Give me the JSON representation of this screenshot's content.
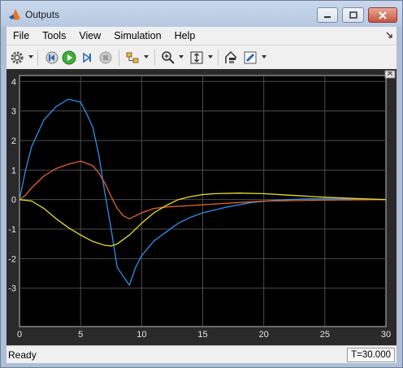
{
  "window": {
    "title": "Outputs"
  },
  "menu": {
    "items": [
      "File",
      "Tools",
      "View",
      "Simulation",
      "Help"
    ]
  },
  "toolbar": {
    "icons": [
      "gear-icon",
      "step-back-icon",
      "run-icon",
      "step-forward-icon",
      "stop-icon",
      "signal-select-icon",
      "zoom-icon",
      "fit-axes-icon",
      "style-icon",
      "highlight-icon"
    ]
  },
  "status": {
    "text": "Ready",
    "time": "T=30.000"
  },
  "chart_data": {
    "type": "line",
    "xlim": [
      0,
      30
    ],
    "ylim": [
      -4.3,
      4.2
    ],
    "x_ticks": [
      0,
      5,
      10,
      15,
      20,
      25,
      30
    ],
    "y_ticks": [
      4,
      3,
      2,
      1,
      0,
      -1,
      -2,
      -3
    ],
    "x_tick_labels": [
      "0",
      "5",
      "10",
      "15",
      "20",
      "25",
      "30"
    ],
    "y_tick_labels": [
      "4",
      "3",
      "2",
      "1",
      "0",
      "-1",
      "-2",
      "-3"
    ],
    "grid": true,
    "series": [
      {
        "color": "#2f8fe6",
        "x": [
          0,
          0.5,
          1,
          2,
          3,
          4,
          5,
          5.5,
          6,
          6.5,
          7,
          7.5,
          8,
          8.5,
          9,
          9.5,
          10,
          11,
          12,
          13,
          14,
          15,
          17,
          19,
          21,
          24,
          27,
          30
        ],
        "y": [
          0,
          1.0,
          1.8,
          2.7,
          3.15,
          3.4,
          3.3,
          2.9,
          2.45,
          1.5,
          0.2,
          -1.0,
          -2.3,
          -2.6,
          -2.9,
          -2.3,
          -1.9,
          -1.4,
          -1.1,
          -0.8,
          -0.6,
          -0.45,
          -0.25,
          -0.1,
          -0.02,
          0.03,
          0.02,
          0.0
        ]
      },
      {
        "color": "#e2632f",
        "x": [
          0,
          0.5,
          1,
          2,
          3,
          4,
          5,
          6,
          6.5,
          7,
          7.5,
          8,
          8.5,
          9,
          10,
          11,
          12,
          14,
          16,
          18,
          20,
          25,
          30
        ],
        "y": [
          0,
          0.15,
          0.4,
          0.8,
          1.05,
          1.2,
          1.3,
          1.15,
          0.9,
          0.55,
          0.1,
          -0.3,
          -0.55,
          -0.65,
          -0.45,
          -0.3,
          -0.25,
          -0.2,
          -0.15,
          -0.1,
          -0.05,
          -0.02,
          0.0
        ]
      },
      {
        "color": "#e7de2b",
        "x": [
          0,
          1,
          2,
          3,
          4,
          5,
          6,
          7,
          7.5,
          8,
          9,
          10,
          11,
          12,
          13,
          14,
          15,
          16,
          18,
          20,
          22,
          25,
          28,
          30
        ],
        "y": [
          0,
          -0.05,
          -0.3,
          -0.65,
          -0.95,
          -1.2,
          -1.42,
          -1.55,
          -1.57,
          -1.5,
          -1.2,
          -0.8,
          -0.45,
          -0.2,
          0.0,
          0.1,
          0.17,
          0.2,
          0.22,
          0.2,
          0.15,
          0.08,
          0.03,
          0.0
        ]
      }
    ]
  }
}
